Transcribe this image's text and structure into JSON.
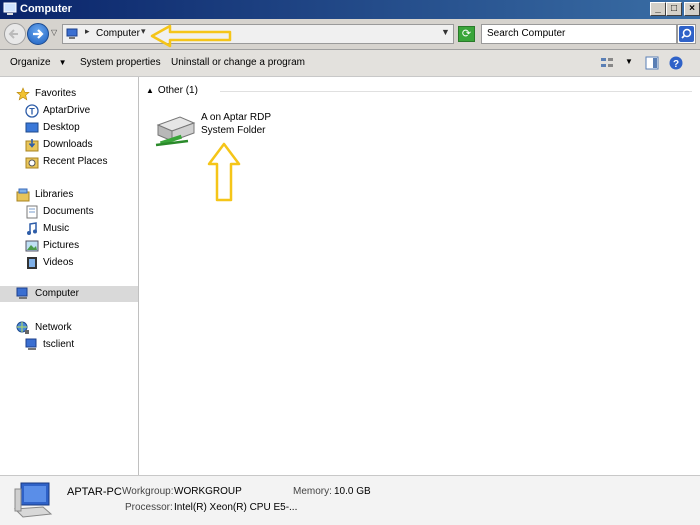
{
  "window": {
    "title": "Computer"
  },
  "address": {
    "path": "Computer",
    "search_placeholder": "Search Computer"
  },
  "toolbar": {
    "organize": "Organize",
    "system_properties": "System properties",
    "uninstall": "Uninstall or change a program"
  },
  "sidebar": {
    "favorites": "Favorites",
    "fav_items": [
      "AptarDrive",
      "Desktop",
      "Downloads",
      "Recent Places"
    ],
    "libraries": "Libraries",
    "lib_items": [
      "Documents",
      "Music",
      "Pictures",
      "Videos"
    ],
    "computer": "Computer",
    "network": "Network",
    "net_items": [
      "tsclient"
    ]
  },
  "content": {
    "group_header": "Other (1)",
    "item": {
      "name": "A on Aptar RDP",
      "type": "System Folder"
    }
  },
  "details": {
    "computer_name": "APTAR-PC",
    "workgroup_label": "Workgroup:",
    "workgroup_value": "WORKGROUP",
    "memory_label": "Memory:",
    "memory_value": "10.0 GB",
    "processor_label": "Processor:",
    "processor_value": "Intel(R) Xeon(R) CPU E5-..."
  },
  "colors": {
    "annotation": "#f5c518",
    "titlebar": "#0a246a",
    "selection": "#d9d9d9"
  }
}
